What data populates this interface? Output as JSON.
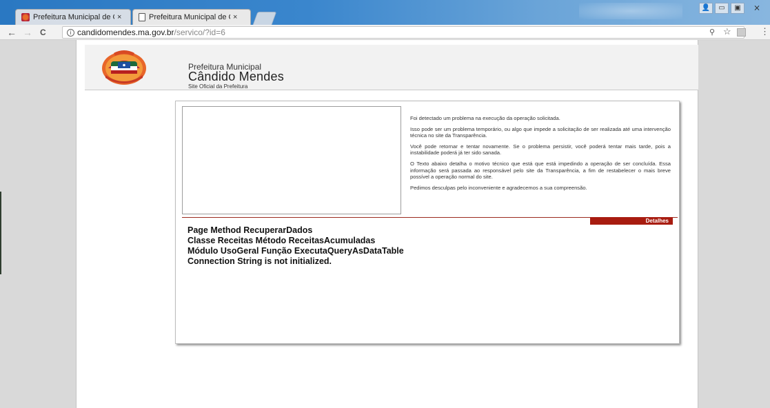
{
  "browser": {
    "tabs": [
      {
        "title": "Prefeitura Municipal de C",
        "close": "×",
        "active": false
      },
      {
        "title": "Prefeitura Municipal de C",
        "close": "×",
        "active": true
      }
    ],
    "url_host": "candidomendes.ma.gov.br",
    "url_path": "/servico/?id=6",
    "back_icon": "←",
    "forward_icon": "→",
    "reload_icon": "C",
    "zoom_icon": "🔍",
    "star_icon": "☆",
    "menu_icon": "⋮",
    "window_close": "⨯"
  },
  "header": {
    "line1": "Prefeitura Municipal",
    "line2": "Cândido Mendes",
    "line3": "Site Oficial da Prefeitura"
  },
  "message": {
    "p1": "Foi detectado um problema na execução da operação solicitada.",
    "p2": "Isso pode ser um problema temporário, ou algo que impede a solicitação de ser realizada até uma intervenção técnica no site da Transparência.",
    "p3": "Você pode retornar e tentar novamente. Se o problema persistir, você poderá tentar mais tarde, pois a instabilidade poderá já ter sido sanada.",
    "p4": "O Texto abaixo detalha o motivo técnico que está que está impedindo a operação de ser concluída. Essa informação será passada ao responsável pelo site da Transparência, a fim de restabelecer o mais breve possível a operação normal do site.",
    "p5": "Pedimos desculpas pelo inconveniente e agradecemos a sua compreensão."
  },
  "details_label": "Detalhes",
  "error_lines": [
    "Page Method RecuperarDados",
    "Classe Receitas Método ReceitasAcumuladas",
    "Módulo UsoGeral Função ExecutaQueryAsDataTable",
    "Connection String is not initialized."
  ],
  "colors": {
    "accent_red": "#a81c10",
    "header_bg": "#f2f2f2"
  }
}
